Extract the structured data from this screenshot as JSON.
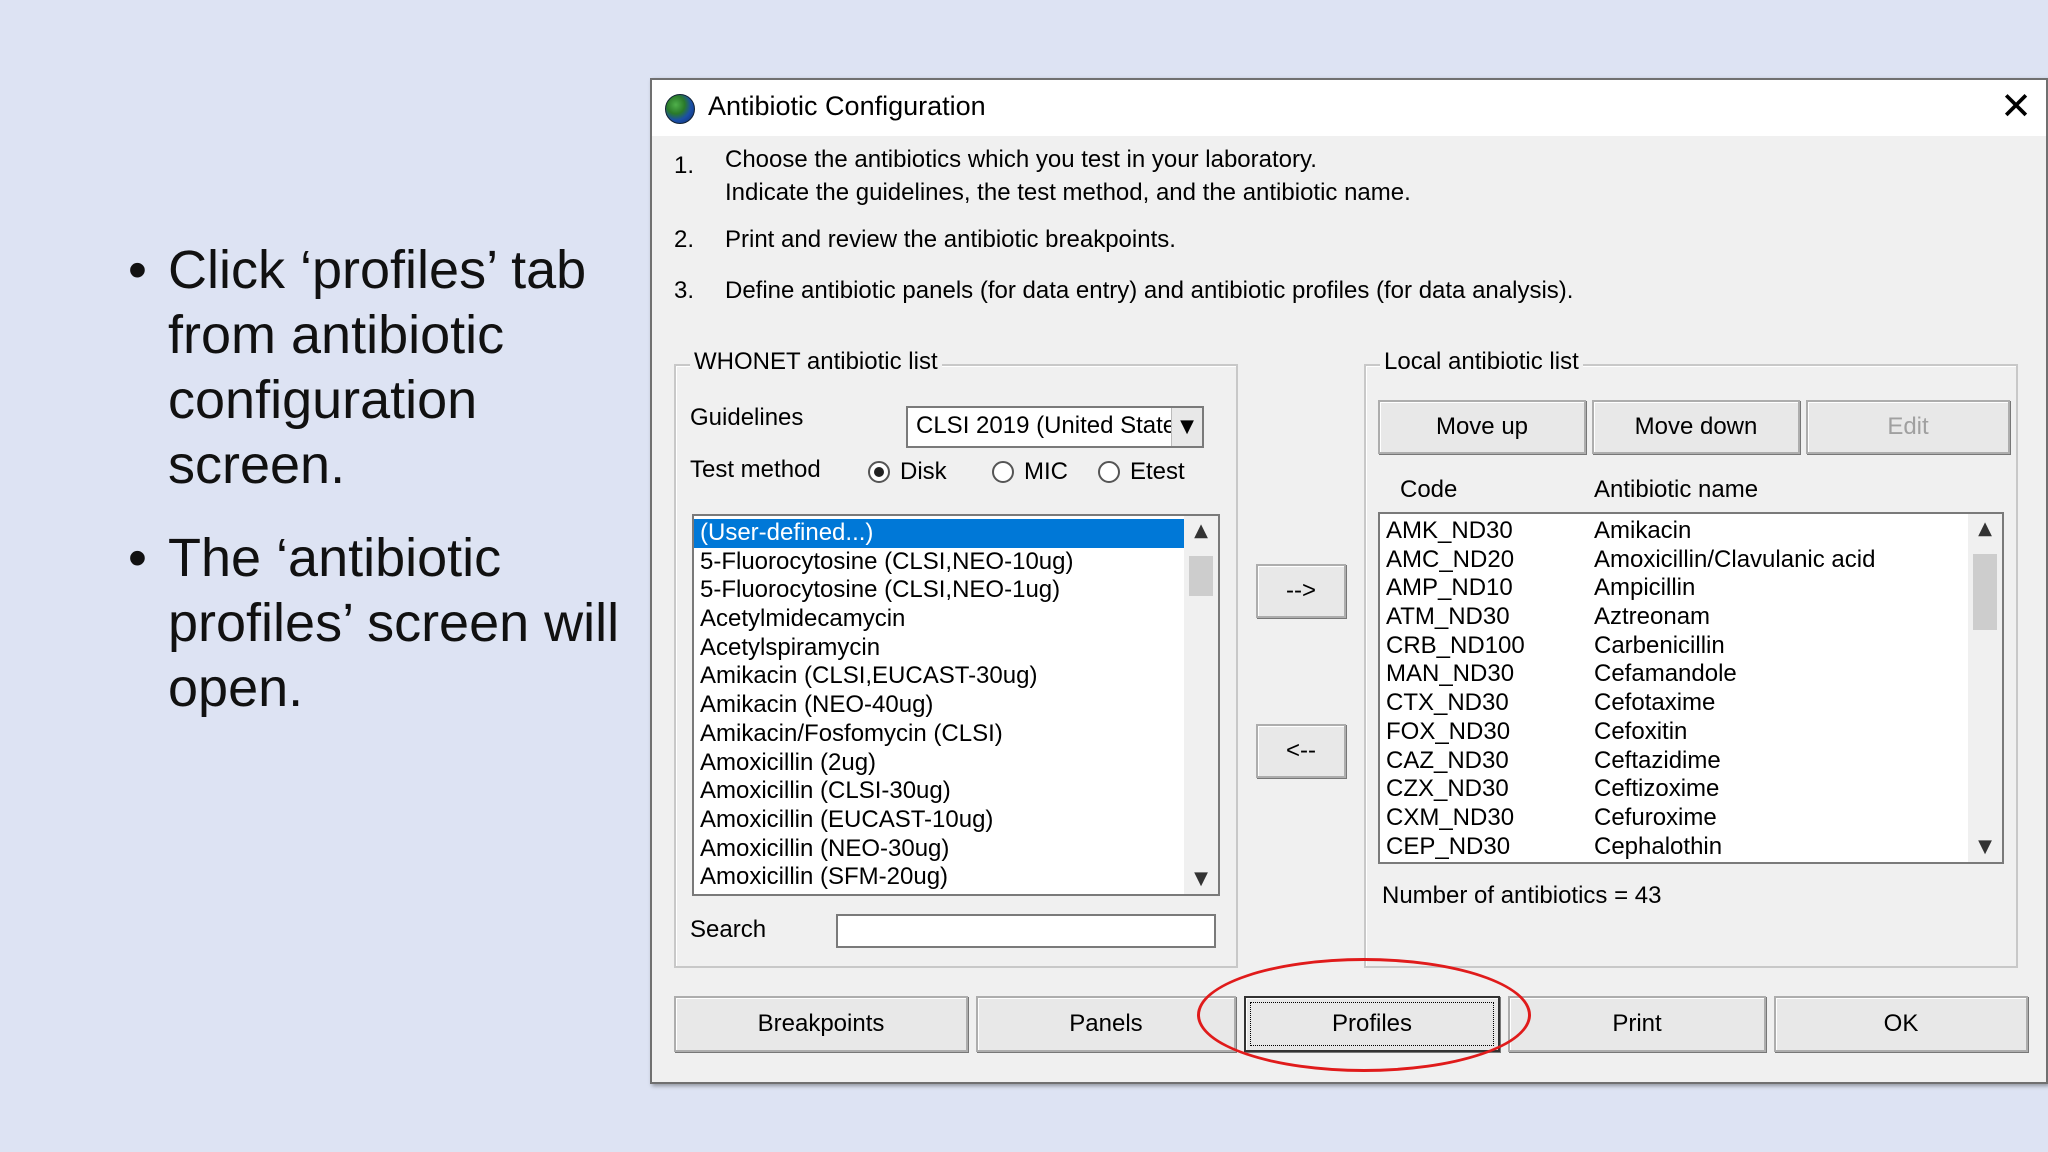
{
  "slide": {
    "bullets": [
      {
        "marker": "•",
        "text": "Click ‘profiles’ tab from antibiotic configuration screen."
      },
      {
        "marker": "•",
        "text": "The ‘antibiotic profiles’ screen will open."
      }
    ]
  },
  "dialog": {
    "title": "Antibiotic Configuration",
    "close_label": "✕",
    "instructions": [
      {
        "num": "1.",
        "line1": "Choose the antibiotics which you test in your laboratory.",
        "line2": "Indicate the guidelines, the test method, and the antibiotic name."
      },
      {
        "num": "2.",
        "line1": "Print and review the antibiotic breakpoints."
      },
      {
        "num": "3.",
        "line1": "Define antibiotic panels (for data entry) and antibiotic profiles (for data analysis)."
      }
    ],
    "whonet_list": {
      "label": "WHONET antibiotic list",
      "guidelines_label": "Guidelines",
      "guidelines_value": "CLSI 2019 (United State",
      "test_method_label": "Test method",
      "methods": [
        {
          "label": "Disk",
          "selected": true
        },
        {
          "label": "MIC",
          "selected": false
        },
        {
          "label": "Etest",
          "selected": false
        }
      ],
      "items": [
        "(User-defined...)",
        "5-Fluorocytosine (CLSI,NEO-10ug)",
        "5-Fluorocytosine (CLSI,NEO-1ug)",
        "Acetylmidecamycin",
        "Acetylspiramycin",
        "Amikacin (CLSI,EUCAST-30ug)",
        "Amikacin (NEO-40ug)",
        "Amikacin/Fosfomycin (CLSI)",
        "Amoxicillin (2ug)",
        "Amoxicillin (CLSI-30ug)",
        "Amoxicillin (EUCAST-10ug)",
        "Amoxicillin (NEO-30ug)",
        "Amoxicillin (SFM-20ug)"
      ],
      "selected_index": 0,
      "search_label": "Search",
      "search_value": ""
    },
    "transfer": {
      "add_label": "-->",
      "remove_label": "<--"
    },
    "local_list": {
      "label": "Local antibiotic list",
      "move_up_label": "Move up",
      "move_down_label": "Move down",
      "edit_label": "Edit",
      "col_code": "Code",
      "col_name": "Antibiotic name",
      "rows": [
        {
          "code": "AMK_ND30",
          "name": "Amikacin"
        },
        {
          "code": "AMC_ND20",
          "name": "Amoxicillin/Clavulanic acid"
        },
        {
          "code": "AMP_ND10",
          "name": "Ampicillin"
        },
        {
          "code": "ATM_ND30",
          "name": "Aztreonam"
        },
        {
          "code": "CRB_ND100",
          "name": "Carbenicillin"
        },
        {
          "code": "MAN_ND30",
          "name": "Cefamandole"
        },
        {
          "code": "CTX_ND30",
          "name": "Cefotaxime"
        },
        {
          "code": "FOX_ND30",
          "name": "Cefoxitin"
        },
        {
          "code": "CAZ_ND30",
          "name": "Ceftazidime"
        },
        {
          "code": "CZX_ND30",
          "name": "Ceftizoxime"
        },
        {
          "code": "CXM_ND30",
          "name": "Cefuroxime"
        },
        {
          "code": "CEP_ND30",
          "name": "Cephalothin"
        }
      ],
      "count_text": "Number of antibiotics = 43"
    },
    "buttons": {
      "breakpoints": "Breakpoints",
      "panels": "Panels",
      "profiles": "Profiles",
      "print": "Print",
      "ok": "OK"
    },
    "highlight_color": "#e01b1b"
  }
}
